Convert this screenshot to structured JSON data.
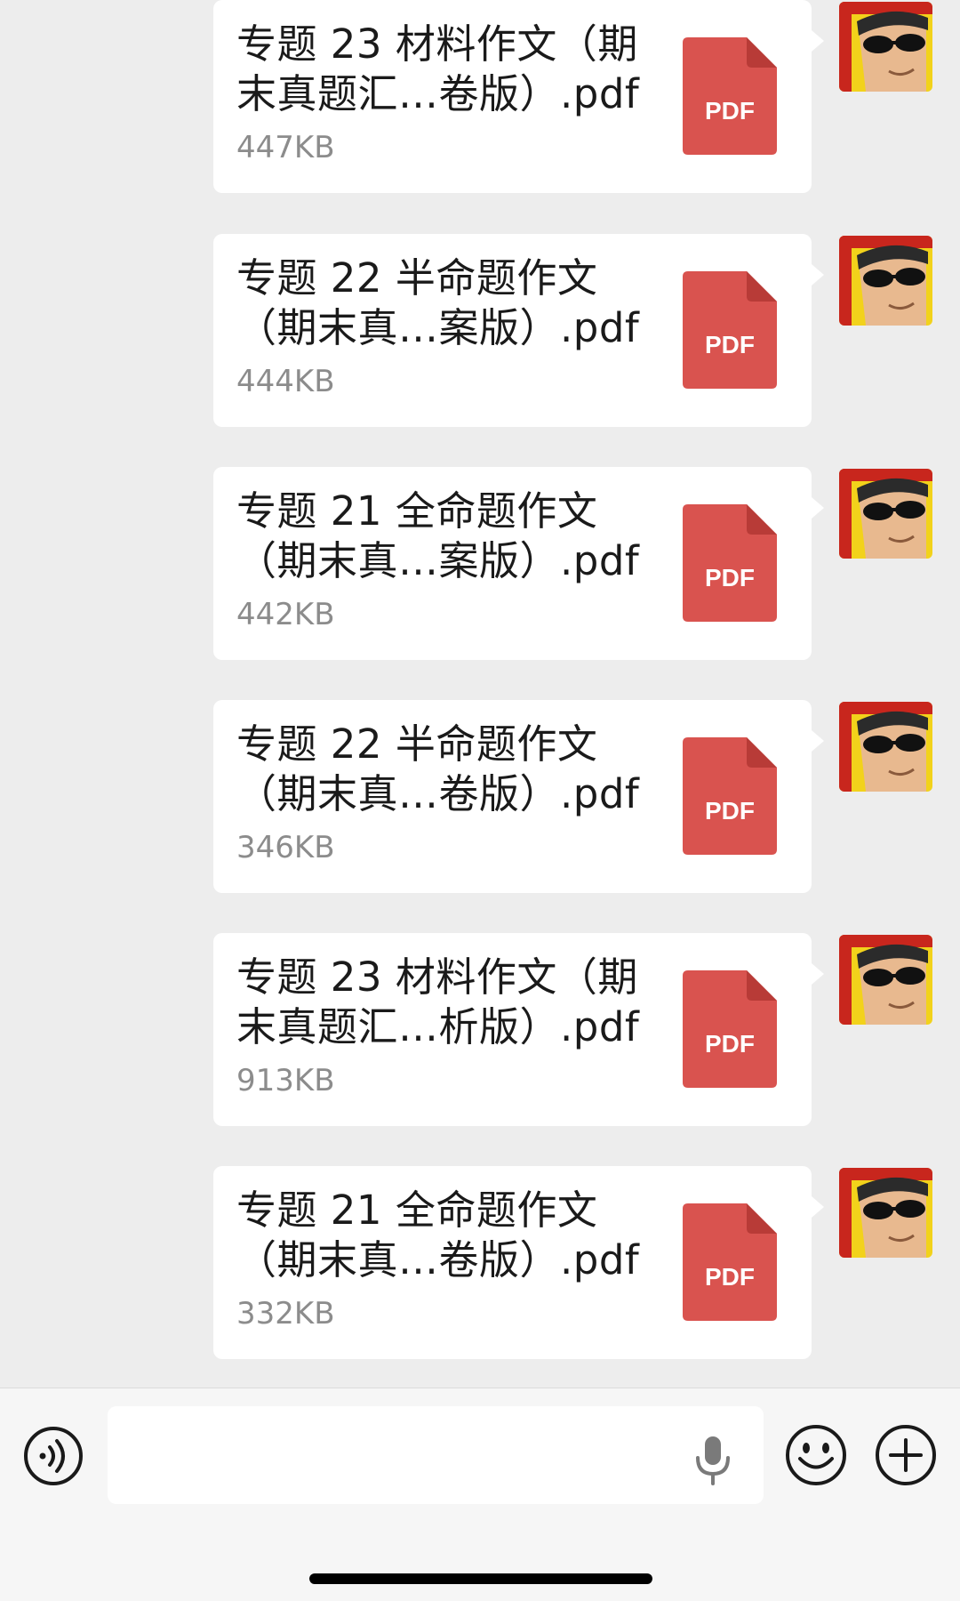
{
  "messages": [
    {
      "name": "专题 23 材料作文（期\n末真题汇…卷版）.pdf",
      "size": "447KB",
      "icon_label": "PDF"
    },
    {
      "name": "专题 22 半命题作文\n（期末真…案版）.pdf",
      "size": "444KB",
      "icon_label": "PDF"
    },
    {
      "name": "专题 21 全命题作文\n（期末真…案版）.pdf",
      "size": "442KB",
      "icon_label": "PDF"
    },
    {
      "name": "专题 22 半命题作文\n（期末真…卷版）.pdf",
      "size": "346KB",
      "icon_label": "PDF"
    },
    {
      "name": "专题 23 材料作文（期\n末真题汇…析版）.pdf",
      "size": "913KB",
      "icon_label": "PDF"
    },
    {
      "name": "专题 21 全命题作文\n（期末真…卷版）.pdf",
      "size": "332KB",
      "icon_label": "PDF"
    }
  ],
  "input": {
    "value": "",
    "placeholder": ""
  },
  "icons": {
    "voice": "voice-icon",
    "mic": "microphone-icon",
    "emoji": "emoji-icon",
    "plus": "plus-icon",
    "file": "pdf-file-icon"
  },
  "colors": {
    "pdf_red": "#d9534f",
    "background": "#ededed",
    "bubble": "#ffffff",
    "size_text": "#8c8c8c"
  }
}
